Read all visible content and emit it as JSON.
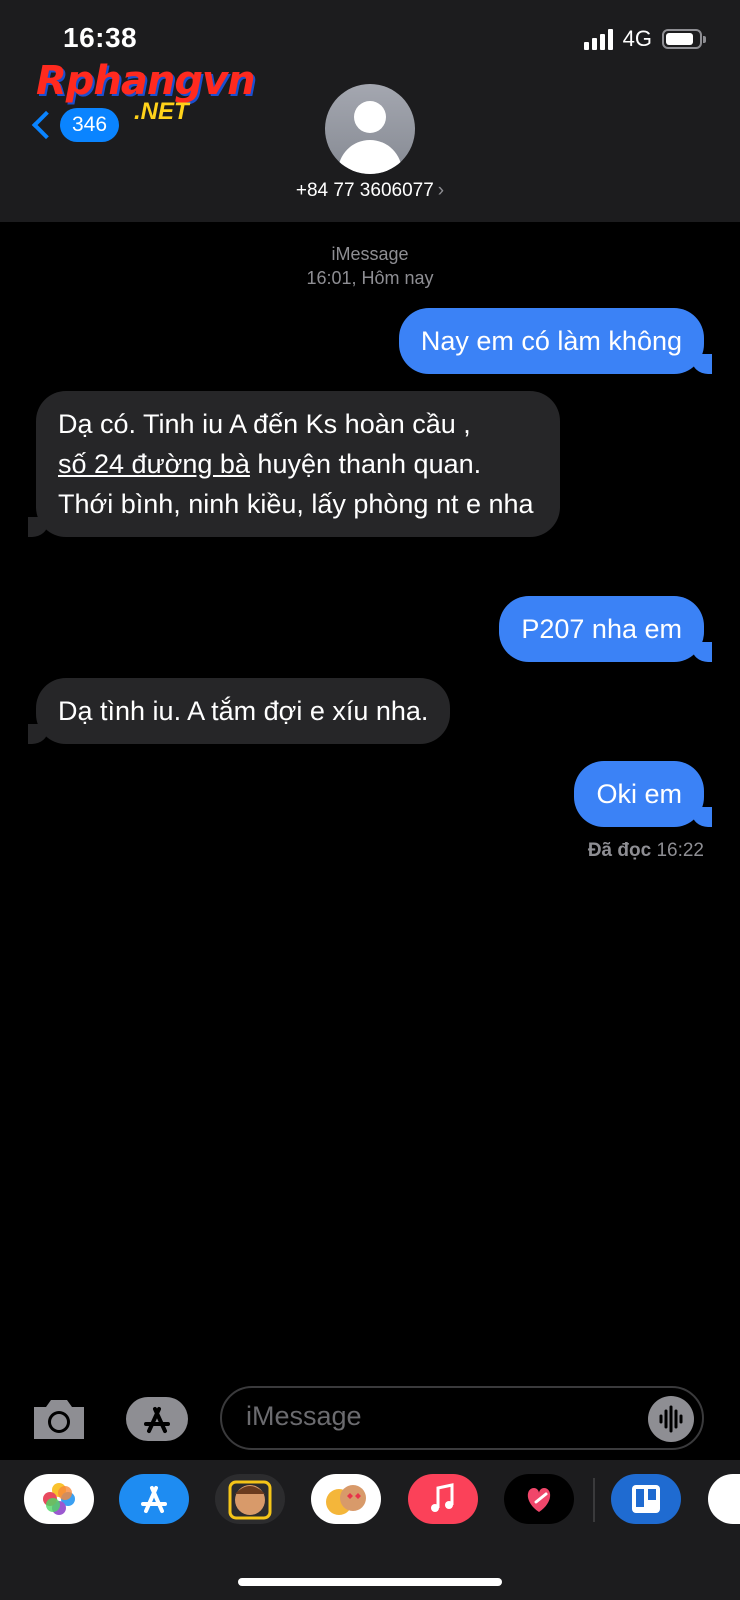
{
  "status_bar": {
    "time": "16:38",
    "network": "4G",
    "signal_icon": "cellular-signal-icon",
    "battery_icon": "battery-icon"
  },
  "watermark": {
    "main": "Rphangvn",
    "sub": ".NET"
  },
  "header": {
    "back_count": "346",
    "contact": "+84 77 3606077",
    "contact_chevron": "›"
  },
  "conversation": {
    "service": "iMessage",
    "timestamp": "16:01, Hôm nay",
    "messages": [
      {
        "direction": "out",
        "text": "Nay em có làm không"
      },
      {
        "direction": "in",
        "text_pre": "Dạ có. Tinh iu A đến Ks hoàn cầu ,",
        "text_link": "số 24 đường bà",
        "text_post": " huyện thanh quan. Thới bình, ninh kiều, lấy phòng nt e nha"
      },
      {
        "direction": "out",
        "text": "P207 nha em"
      },
      {
        "direction": "in",
        "text": "Dạ tình iu. A tắm đợi e xíu nha."
      },
      {
        "direction": "out",
        "text": "Oki em"
      }
    ],
    "read_label": "Đã đọc",
    "read_time": "16:22"
  },
  "composer": {
    "placeholder": "iMessage"
  },
  "app_drawer": [
    {
      "icon": "photos-app-icon",
      "color": "#ffffff"
    },
    {
      "icon": "app-store-icon",
      "color": "#1e8cf2"
    },
    {
      "icon": "memoji-icon",
      "color": "#2c2c2e"
    },
    {
      "icon": "memoji-stickers-icon",
      "color": "#ffffff"
    },
    {
      "icon": "music-app-icon",
      "color": "#fb4159"
    },
    {
      "icon": "digital-touch-icon",
      "color": "#000000"
    },
    {
      "icon": "trello-icon",
      "color": "#1f6bd1"
    }
  ],
  "colors": {
    "accent": "#0a84ff",
    "outgoing_bubble": "#3b82f6",
    "incoming_bubble": "#262628"
  }
}
